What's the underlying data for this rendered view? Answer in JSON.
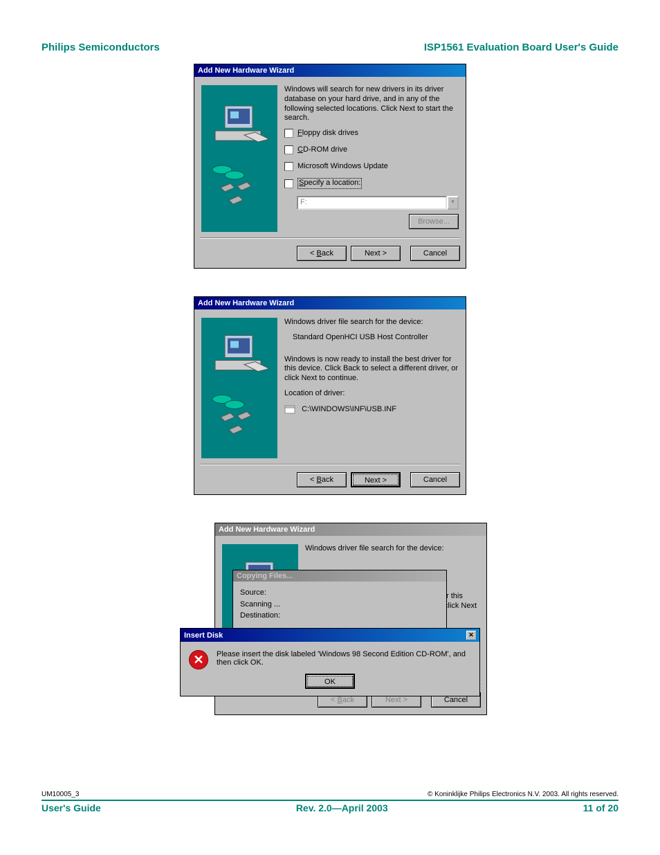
{
  "header": {
    "left": "Philips Semiconductors",
    "right": "ISP1561 Evaluation Board User's Guide"
  },
  "dialog1": {
    "title": "Add New Hardware Wizard",
    "intro": "Windows will search for new drivers in its driver database on your hard drive, and in any of the following selected locations. Click Next to start the search.",
    "opt_floppy": "Floppy disk drives",
    "opt_cdrom": "CD-ROM drive",
    "opt_winupdate": "Microsoft Windows Update",
    "opt_specify": "Specify a location:",
    "combo_value": "F:",
    "browse": "Browse...",
    "back": "< Back",
    "next": "Next >",
    "cancel": "Cancel"
  },
  "dialog2": {
    "title": "Add New Hardware Wizard",
    "line1": "Windows driver file search for the device:",
    "device": "Standard OpenHCI USB Host Controller",
    "line2": "Windows is now ready to install the best driver for this device. Click Back to select a different driver, or click Next to continue.",
    "loc_label": "Location of driver:",
    "loc_path": "C:\\WINDOWS\\INF\\USB.INF",
    "back": "< Back",
    "next": "Next >",
    "cancel": "Cancel"
  },
  "dialog3": {
    "title": "Add New Hardware Wizard",
    "line1": "Windows driver file search for the device:",
    "bg_frag1": "er for this",
    "bg_frag2": ", or click Next",
    "copy_title": "Copying Files...",
    "copy_source": "Source:",
    "copy_scan": "Scanning ...",
    "copy_dest": "Destination:",
    "insert_title": "Insert Disk",
    "insert_msg": "Please insert the disk labeled 'Windows 98 Second Edition CD-ROM', and then click OK.",
    "ok": "OK",
    "back": "< Back",
    "next": "Next >",
    "cancel": "Cancel"
  },
  "footer": {
    "doc_id": "UM10005_3",
    "copyright": "© Koninklijke Philips Electronics N.V. 2003. All rights reserved.",
    "left": "User's Guide",
    "center": "Rev. 2.0—April 2003",
    "right": "11 of 20"
  }
}
